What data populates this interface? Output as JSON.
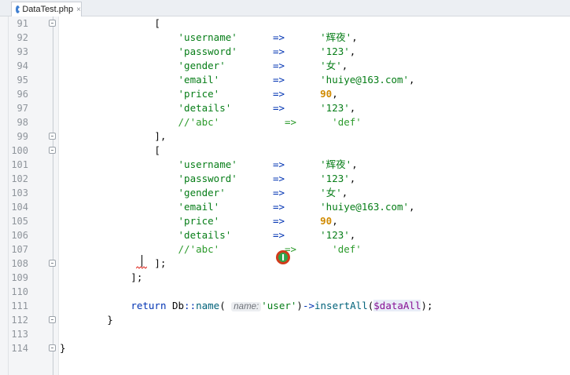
{
  "tab": {
    "filename": "DataTest.php",
    "close_glyph": "×",
    "icon": "php-class-icon"
  },
  "lines": [
    {
      "num": "91",
      "tokens": [
        {
          "t": "                [",
          "c": ""
        }
      ]
    },
    {
      "num": "92",
      "tokens": [
        {
          "t": "                    ",
          "c": ""
        },
        {
          "t": "'username'",
          "c": "tok-key"
        },
        {
          "t": "      ",
          "c": ""
        },
        {
          "t": "=>",
          "c": "tok-arrow"
        },
        {
          "t": "      ",
          "c": ""
        },
        {
          "t": "'辉夜'",
          "c": "tok-str"
        },
        {
          "t": ",",
          "c": ""
        }
      ]
    },
    {
      "num": "93",
      "tokens": [
        {
          "t": "                    ",
          "c": ""
        },
        {
          "t": "'password'",
          "c": "tok-key"
        },
        {
          "t": "      ",
          "c": ""
        },
        {
          "t": "=>",
          "c": "tok-arrow"
        },
        {
          "t": "      ",
          "c": ""
        },
        {
          "t": "'123'",
          "c": "tok-str"
        },
        {
          "t": ",",
          "c": ""
        }
      ]
    },
    {
      "num": "94",
      "tokens": [
        {
          "t": "                    ",
          "c": ""
        },
        {
          "t": "'gender'",
          "c": "tok-key"
        },
        {
          "t": "        ",
          "c": ""
        },
        {
          "t": "=>",
          "c": "tok-arrow"
        },
        {
          "t": "      ",
          "c": ""
        },
        {
          "t": "'女'",
          "c": "tok-str"
        },
        {
          "t": ",",
          "c": ""
        }
      ]
    },
    {
      "num": "95",
      "tokens": [
        {
          "t": "                    ",
          "c": ""
        },
        {
          "t": "'email'",
          "c": "tok-key"
        },
        {
          "t": "         ",
          "c": ""
        },
        {
          "t": "=>",
          "c": "tok-arrow"
        },
        {
          "t": "      ",
          "c": ""
        },
        {
          "t": "'huiye@163.com'",
          "c": "tok-str"
        },
        {
          "t": ",",
          "c": ""
        }
      ]
    },
    {
      "num": "96",
      "tokens": [
        {
          "t": "                    ",
          "c": ""
        },
        {
          "t": "'price'",
          "c": "tok-key"
        },
        {
          "t": "         ",
          "c": ""
        },
        {
          "t": "=>",
          "c": "tok-arrow"
        },
        {
          "t": "      ",
          "c": ""
        },
        {
          "t": "90",
          "c": "tok-num"
        },
        {
          "t": ",",
          "c": ""
        }
      ]
    },
    {
      "num": "97",
      "tokens": [
        {
          "t": "                    ",
          "c": ""
        },
        {
          "t": "'details'",
          "c": "tok-key"
        },
        {
          "t": "       ",
          "c": ""
        },
        {
          "t": "=>",
          "c": "tok-arrow"
        },
        {
          "t": "      ",
          "c": ""
        },
        {
          "t": "'123'",
          "c": "tok-str"
        },
        {
          "t": ",",
          "c": ""
        }
      ]
    },
    {
      "num": "98",
      "tokens": [
        {
          "t": "                    ",
          "c": ""
        },
        {
          "t": "//'abc'           =>      'def'",
          "c": "tok-comment"
        }
      ]
    },
    {
      "num": "99",
      "tokens": [
        {
          "t": "                ],",
          "c": ""
        }
      ]
    },
    {
      "num": "100",
      "tokens": [
        {
          "t": "                [",
          "c": ""
        }
      ]
    },
    {
      "num": "101",
      "tokens": [
        {
          "t": "                    ",
          "c": ""
        },
        {
          "t": "'username'",
          "c": "tok-key"
        },
        {
          "t": "      ",
          "c": ""
        },
        {
          "t": "=>",
          "c": "tok-arrow"
        },
        {
          "t": "      ",
          "c": ""
        },
        {
          "t": "'辉夜'",
          "c": "tok-str"
        },
        {
          "t": ",",
          "c": ""
        }
      ]
    },
    {
      "num": "102",
      "tokens": [
        {
          "t": "                    ",
          "c": ""
        },
        {
          "t": "'password'",
          "c": "tok-key"
        },
        {
          "t": "      ",
          "c": ""
        },
        {
          "t": "=>",
          "c": "tok-arrow"
        },
        {
          "t": "      ",
          "c": ""
        },
        {
          "t": "'123'",
          "c": "tok-str"
        },
        {
          "t": ",",
          "c": ""
        }
      ]
    },
    {
      "num": "103",
      "tokens": [
        {
          "t": "                    ",
          "c": ""
        },
        {
          "t": "'gender'",
          "c": "tok-key"
        },
        {
          "t": "        ",
          "c": ""
        },
        {
          "t": "=>",
          "c": "tok-arrow"
        },
        {
          "t": "      ",
          "c": ""
        },
        {
          "t": "'女'",
          "c": "tok-str"
        },
        {
          "t": ",",
          "c": ""
        }
      ]
    },
    {
      "num": "104",
      "tokens": [
        {
          "t": "                    ",
          "c": ""
        },
        {
          "t": "'email'",
          "c": "tok-key"
        },
        {
          "t": "         ",
          "c": ""
        },
        {
          "t": "=>",
          "c": "tok-arrow"
        },
        {
          "t": "      ",
          "c": ""
        },
        {
          "t": "'huiye@163.com'",
          "c": "tok-str"
        },
        {
          "t": ",",
          "c": ""
        }
      ]
    },
    {
      "num": "105",
      "tokens": [
        {
          "t": "                    ",
          "c": ""
        },
        {
          "t": "'price'",
          "c": "tok-key"
        },
        {
          "t": "         ",
          "c": ""
        },
        {
          "t": "=>",
          "c": "tok-arrow"
        },
        {
          "t": "      ",
          "c": ""
        },
        {
          "t": "90",
          "c": "tok-num"
        },
        {
          "t": ",",
          "c": ""
        }
      ]
    },
    {
      "num": "106",
      "tokens": [
        {
          "t": "                    ",
          "c": ""
        },
        {
          "t": "'details'",
          "c": "tok-key"
        },
        {
          "t": "       ",
          "c": ""
        },
        {
          "t": "=>",
          "c": "tok-arrow"
        },
        {
          "t": "      ",
          "c": ""
        },
        {
          "t": "'123'",
          "c": "tok-str"
        },
        {
          "t": ",",
          "c": ""
        }
      ]
    },
    {
      "num": "107",
      "tokens": [
        {
          "t": "                    ",
          "c": ""
        },
        {
          "t": "//'abc'           =>      'def'",
          "c": "tok-comment"
        }
      ]
    },
    {
      "num": "108",
      "tokens": [
        {
          "t": "                ];",
          "c": ""
        }
      ]
    },
    {
      "num": "109",
      "tokens": [
        {
          "t": "            ];",
          "c": ""
        }
      ]
    },
    {
      "num": "110",
      "tokens": [
        {
          "t": "",
          "c": ""
        }
      ]
    },
    {
      "num": "111",
      "tokens": [
        {
          "t": "            ",
          "c": ""
        },
        {
          "t": "return",
          "c": "tok-kw"
        },
        {
          "t": " Db",
          "c": ""
        },
        {
          "t": "::",
          "c": "tok-arrow"
        },
        {
          "t": "name",
          "c": "tok-fn"
        },
        {
          "t": "( ",
          "c": ""
        },
        {
          "t": "name:",
          "c": "tok-hint"
        },
        {
          "t": "'user'",
          "c": "tok-str"
        },
        {
          "t": ")",
          "c": ""
        },
        {
          "t": "->",
          "c": "tok-arrow"
        },
        {
          "t": "insertAll",
          "c": "tok-fn"
        },
        {
          "t": "(",
          "c": ""
        },
        {
          "t": "$dataAll",
          "c": "tok-var"
        },
        {
          "t": ");",
          "c": ""
        }
      ]
    },
    {
      "num": "112",
      "tokens": [
        {
          "t": "        }",
          "c": ""
        }
      ]
    },
    {
      "num": "113",
      "tokens": [
        {
          "t": "",
          "c": ""
        }
      ]
    },
    {
      "num": "114",
      "tokens": [
        {
          "t": "}",
          "c": ""
        }
      ]
    }
  ],
  "fold_markers": [
    "91",
    "99",
    "100",
    "108",
    "112",
    "114"
  ],
  "colors": {
    "string": "#067d17",
    "keyword": "#0033b3",
    "number": "#d08a00",
    "comment": "#2b9a2b",
    "function": "#00627a",
    "variable": "#871094"
  }
}
